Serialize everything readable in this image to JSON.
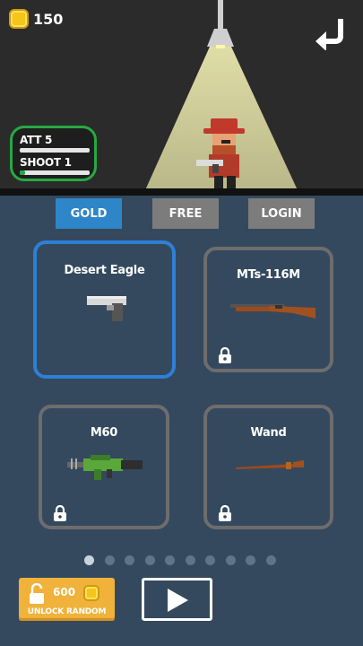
{
  "hud": {
    "coins": "150",
    "coin_icon": "coin-icon",
    "back_icon": "return-arrow-icon"
  },
  "stats": {
    "att_label": "ATT 5",
    "att_level": 0.0,
    "shoot_label": "SHOOT 1",
    "shoot_level": 0.08
  },
  "tabs": [
    {
      "label": "GOLD",
      "active": true
    },
    {
      "label": "FREE",
      "active": false
    },
    {
      "label": "LOGIN",
      "active": false
    }
  ],
  "weapons": [
    {
      "name": "Desert Eagle",
      "selected": true,
      "locked": false,
      "icon": "pistol-icon"
    },
    {
      "name": "MTs-116M",
      "selected": false,
      "locked": true,
      "icon": "rifle-icon"
    },
    {
      "name": "M60",
      "selected": false,
      "locked": true,
      "icon": "machine-gun-icon"
    },
    {
      "name": "Wand",
      "selected": false,
      "locked": true,
      "icon": "wand-icon"
    }
  ],
  "pagination": {
    "total": 10,
    "current": 1
  },
  "actions": {
    "unlock_cost": "600",
    "unlock_label": "UNLOCK RANDOM",
    "play_icon": "play-icon"
  },
  "colors": {
    "panel_bg": "#34495e",
    "gold": "#f0b23b",
    "accent_blue": "#2e86c8",
    "green": "#27a844"
  }
}
